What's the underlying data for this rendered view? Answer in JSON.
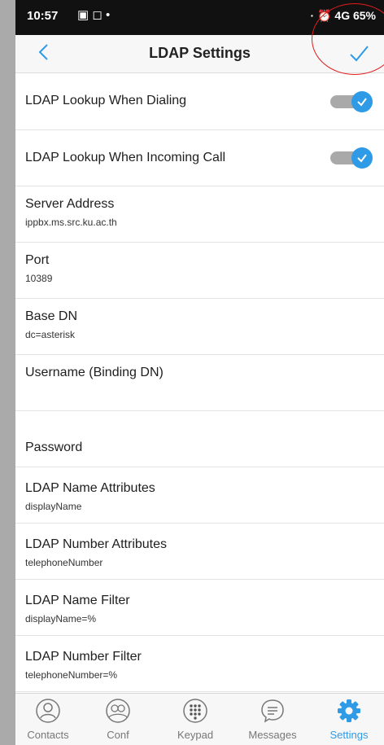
{
  "status_bar": {
    "time": "10:57",
    "right": "· ⏰ 4G 65%"
  },
  "header": {
    "title": "LDAP Settings"
  },
  "rows": [
    {
      "label": "LDAP Lookup When Dialing"
    },
    {
      "label": "LDAP Lookup When Incoming Call"
    },
    {
      "label": "Server Address",
      "value": "ippbx.ms.src.ku.ac.th"
    },
    {
      "label": "Port",
      "value": "10389"
    },
    {
      "label": "Base DN",
      "value": "dc=asterisk"
    },
    {
      "label": "Username (Binding DN)",
      "value": ""
    },
    {
      "label": "Password",
      "value": ""
    },
    {
      "label": "LDAP Name Attributes",
      "value": "displayName"
    },
    {
      "label": "LDAP Number Attributes",
      "value": "telephoneNumber"
    },
    {
      "label": "LDAP Name Filter",
      "value": "displayName=%"
    },
    {
      "label": "LDAP Number Filter",
      "value": "telephoneNumber=%"
    }
  ],
  "toggles": {
    "dialing": true,
    "incoming_call": true
  },
  "tabs": [
    {
      "label": "Contacts",
      "icon": "contacts-icon"
    },
    {
      "label": "Conf",
      "icon": "conference-icon"
    },
    {
      "label": "Keypad",
      "icon": "keypad-icon"
    },
    {
      "label": "Messages",
      "icon": "messages-icon"
    },
    {
      "label": "Settings",
      "icon": "gear-icon",
      "active": true
    }
  ],
  "colors": {
    "accent": "#2f9ae6",
    "annotation": "#e11c1c",
    "toggle_track": "#a9a9a9"
  }
}
